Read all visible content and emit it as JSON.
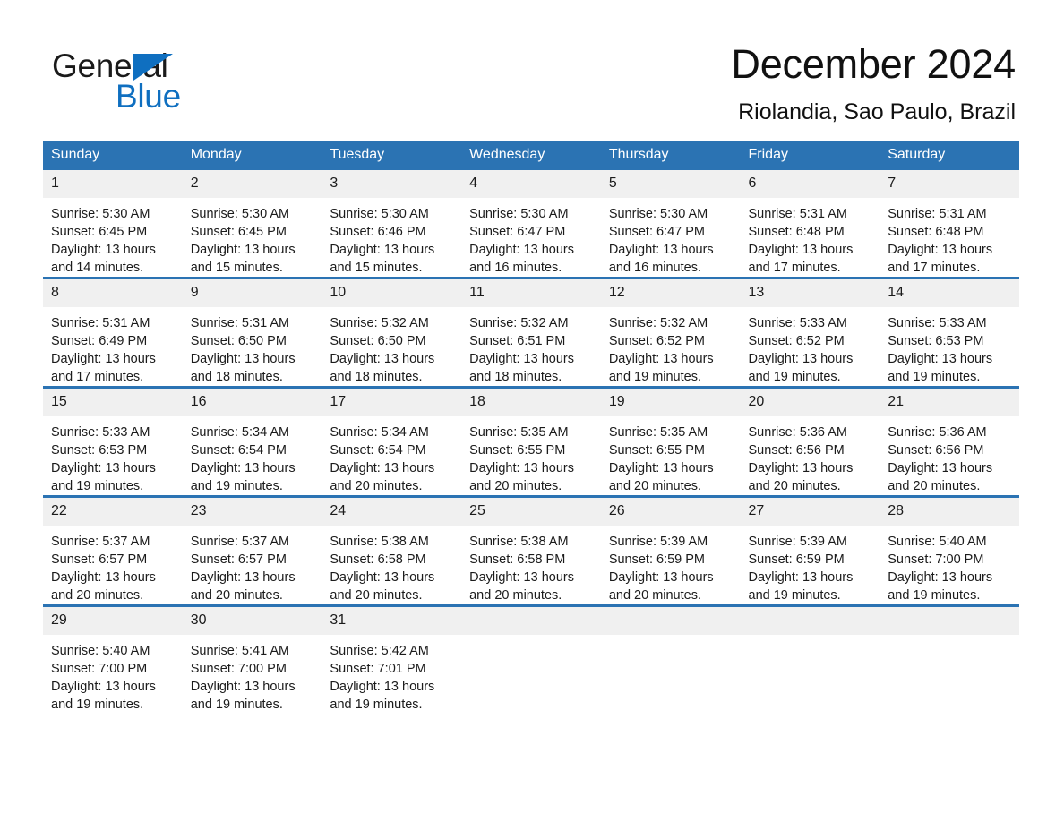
{
  "brand": {
    "name_part1": "General",
    "name_part2": "Blue",
    "triangle_color": "#0f6fc0"
  },
  "header": {
    "month_title": "December 2024",
    "location": "Riolandia, Sao Paulo, Brazil"
  },
  "theme": {
    "header_blue": "#2b73b3",
    "daynum_gray": "#f0f0f0",
    "text_dark": "#1b1b1b"
  },
  "weekdays": [
    "Sunday",
    "Monday",
    "Tuesday",
    "Wednesday",
    "Thursday",
    "Friday",
    "Saturday"
  ],
  "weeks": [
    [
      {
        "day": "1",
        "sunrise": "Sunrise: 5:30 AM",
        "sunset": "Sunset: 6:45 PM",
        "daylight": "Daylight: 13 hours and 14 minutes."
      },
      {
        "day": "2",
        "sunrise": "Sunrise: 5:30 AM",
        "sunset": "Sunset: 6:45 PM",
        "daylight": "Daylight: 13 hours and 15 minutes."
      },
      {
        "day": "3",
        "sunrise": "Sunrise: 5:30 AM",
        "sunset": "Sunset: 6:46 PM",
        "daylight": "Daylight: 13 hours and 15 minutes."
      },
      {
        "day": "4",
        "sunrise": "Sunrise: 5:30 AM",
        "sunset": "Sunset: 6:47 PM",
        "daylight": "Daylight: 13 hours and 16 minutes."
      },
      {
        "day": "5",
        "sunrise": "Sunrise: 5:30 AM",
        "sunset": "Sunset: 6:47 PM",
        "daylight": "Daylight: 13 hours and 16 minutes."
      },
      {
        "day": "6",
        "sunrise": "Sunrise: 5:31 AM",
        "sunset": "Sunset: 6:48 PM",
        "daylight": "Daylight: 13 hours and 17 minutes."
      },
      {
        "day": "7",
        "sunrise": "Sunrise: 5:31 AM",
        "sunset": "Sunset: 6:48 PM",
        "daylight": "Daylight: 13 hours and 17 minutes."
      }
    ],
    [
      {
        "day": "8",
        "sunrise": "Sunrise: 5:31 AM",
        "sunset": "Sunset: 6:49 PM",
        "daylight": "Daylight: 13 hours and 17 minutes."
      },
      {
        "day": "9",
        "sunrise": "Sunrise: 5:31 AM",
        "sunset": "Sunset: 6:50 PM",
        "daylight": "Daylight: 13 hours and 18 minutes."
      },
      {
        "day": "10",
        "sunrise": "Sunrise: 5:32 AM",
        "sunset": "Sunset: 6:50 PM",
        "daylight": "Daylight: 13 hours and 18 minutes."
      },
      {
        "day": "11",
        "sunrise": "Sunrise: 5:32 AM",
        "sunset": "Sunset: 6:51 PM",
        "daylight": "Daylight: 13 hours and 18 minutes."
      },
      {
        "day": "12",
        "sunrise": "Sunrise: 5:32 AM",
        "sunset": "Sunset: 6:52 PM",
        "daylight": "Daylight: 13 hours and 19 minutes."
      },
      {
        "day": "13",
        "sunrise": "Sunrise: 5:33 AM",
        "sunset": "Sunset: 6:52 PM",
        "daylight": "Daylight: 13 hours and 19 minutes."
      },
      {
        "day": "14",
        "sunrise": "Sunrise: 5:33 AM",
        "sunset": "Sunset: 6:53 PM",
        "daylight": "Daylight: 13 hours and 19 minutes."
      }
    ],
    [
      {
        "day": "15",
        "sunrise": "Sunrise: 5:33 AM",
        "sunset": "Sunset: 6:53 PM",
        "daylight": "Daylight: 13 hours and 19 minutes."
      },
      {
        "day": "16",
        "sunrise": "Sunrise: 5:34 AM",
        "sunset": "Sunset: 6:54 PM",
        "daylight": "Daylight: 13 hours and 19 minutes."
      },
      {
        "day": "17",
        "sunrise": "Sunrise: 5:34 AM",
        "sunset": "Sunset: 6:54 PM",
        "daylight": "Daylight: 13 hours and 20 minutes."
      },
      {
        "day": "18",
        "sunrise": "Sunrise: 5:35 AM",
        "sunset": "Sunset: 6:55 PM",
        "daylight": "Daylight: 13 hours and 20 minutes."
      },
      {
        "day": "19",
        "sunrise": "Sunrise: 5:35 AM",
        "sunset": "Sunset: 6:55 PM",
        "daylight": "Daylight: 13 hours and 20 minutes."
      },
      {
        "day": "20",
        "sunrise": "Sunrise: 5:36 AM",
        "sunset": "Sunset: 6:56 PM",
        "daylight": "Daylight: 13 hours and 20 minutes."
      },
      {
        "day": "21",
        "sunrise": "Sunrise: 5:36 AM",
        "sunset": "Sunset: 6:56 PM",
        "daylight": "Daylight: 13 hours and 20 minutes."
      }
    ],
    [
      {
        "day": "22",
        "sunrise": "Sunrise: 5:37 AM",
        "sunset": "Sunset: 6:57 PM",
        "daylight": "Daylight: 13 hours and 20 minutes."
      },
      {
        "day": "23",
        "sunrise": "Sunrise: 5:37 AM",
        "sunset": "Sunset: 6:57 PM",
        "daylight": "Daylight: 13 hours and 20 minutes."
      },
      {
        "day": "24",
        "sunrise": "Sunrise: 5:38 AM",
        "sunset": "Sunset: 6:58 PM",
        "daylight": "Daylight: 13 hours and 20 minutes."
      },
      {
        "day": "25",
        "sunrise": "Sunrise: 5:38 AM",
        "sunset": "Sunset: 6:58 PM",
        "daylight": "Daylight: 13 hours and 20 minutes."
      },
      {
        "day": "26",
        "sunrise": "Sunrise: 5:39 AM",
        "sunset": "Sunset: 6:59 PM",
        "daylight": "Daylight: 13 hours and 20 minutes."
      },
      {
        "day": "27",
        "sunrise": "Sunrise: 5:39 AM",
        "sunset": "Sunset: 6:59 PM",
        "daylight": "Daylight: 13 hours and 19 minutes."
      },
      {
        "day": "28",
        "sunrise": "Sunrise: 5:40 AM",
        "sunset": "Sunset: 7:00 PM",
        "daylight": "Daylight: 13 hours and 19 minutes."
      }
    ],
    [
      {
        "day": "29",
        "sunrise": "Sunrise: 5:40 AM",
        "sunset": "Sunset: 7:00 PM",
        "daylight": "Daylight: 13 hours and 19 minutes."
      },
      {
        "day": "30",
        "sunrise": "Sunrise: 5:41 AM",
        "sunset": "Sunset: 7:00 PM",
        "daylight": "Daylight: 13 hours and 19 minutes."
      },
      {
        "day": "31",
        "sunrise": "Sunrise: 5:42 AM",
        "sunset": "Sunset: 7:01 PM",
        "daylight": "Daylight: 13 hours and 19 minutes."
      },
      {
        "day": "",
        "sunrise": "",
        "sunset": "",
        "daylight": ""
      },
      {
        "day": "",
        "sunrise": "",
        "sunset": "",
        "daylight": ""
      },
      {
        "day": "",
        "sunrise": "",
        "sunset": "",
        "daylight": ""
      },
      {
        "day": "",
        "sunrise": "",
        "sunset": "",
        "daylight": ""
      }
    ]
  ]
}
